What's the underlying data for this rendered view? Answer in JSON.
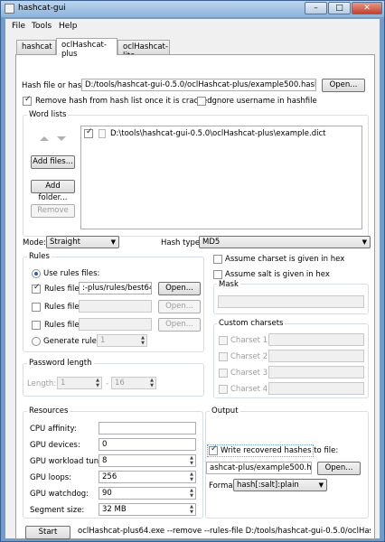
{
  "window": {
    "title": "hashcat-gui",
    "minimize": "–",
    "maximize": "□",
    "close": "✕"
  },
  "menu": [
    "File",
    "Tools",
    "Help"
  ],
  "tabs": [
    "hashcat",
    "oclHashcat-plus",
    "oclHashcat-lite"
  ],
  "hashfile": {
    "label": "Hash file or hash:",
    "value": "D:/tools/hashcat-gui-0.5.0/oclHashcat-plus/example500.hash",
    "open": "Open..."
  },
  "options": {
    "remove_hash": "Remove hash from hash list once it is cracked",
    "ignore_username": "Ignore username in hashfile"
  },
  "wordlists": {
    "title": "Word lists",
    "items": [
      "D:\\tools\\hashcat-gui-0.5.0\\oclHashcat-plus\\example.dict"
    ],
    "add_files": "Add files...",
    "add_folder": "Add folder...",
    "remove": "Remove"
  },
  "mode": {
    "label": "Mode:",
    "value": "Straight"
  },
  "hashtype": {
    "label": "Hash type:",
    "value": "MD5"
  },
  "rules": {
    "title": "Rules",
    "use_rules_files": "Use rules files:",
    "rules_file_label": "Rules file:",
    "rules_file_1": ":-plus/rules/best64.rule",
    "open": "Open...",
    "generate_rules": "Generate rules:",
    "generate_value": "1"
  },
  "charset": {
    "assume_hex": "Assume charset is given in hex",
    "assume_salt_hex": "Assume salt is given in hex"
  },
  "mask": {
    "title": "Mask"
  },
  "custom_charsets": {
    "title": "Custom charsets",
    "items": [
      "Charset 1:",
      "Charset 2:",
      "Charset 3:",
      "Charset 4:"
    ]
  },
  "password_length": {
    "title": "Password length",
    "label": "Length:",
    "min": "1",
    "separator": "-",
    "max": "16"
  },
  "resources": {
    "title": "Resources",
    "cpu_affinity": {
      "label": "CPU affinity:",
      "value": ""
    },
    "gpu_devices": {
      "label": "GPU devices:",
      "value": "0"
    },
    "gpu_workload": {
      "label": "GPU workload tuning:",
      "value": "8"
    },
    "gpu_loops": {
      "label": "GPU loops:",
      "value": "256"
    },
    "gpu_watchdog": {
      "label": "GPU watchdog:",
      "value": "90"
    },
    "segment_size": {
      "label": "Segment size:",
      "value": "32 MB"
    }
  },
  "output": {
    "title": "Output",
    "write_recovered": "Write recovered hashes to file:",
    "file_value": "ashcat-plus/example500.hash.out",
    "open": "Open...",
    "format_label": "Format:",
    "format_value": "hash[:salt]:plain"
  },
  "footer": {
    "start": "Start",
    "command": "oclHashcat-plus64.exe --remove --rules-file D:/tools/hashcat-gui-0.5.0/oclHashcat-plus/rules/best64.rule"
  }
}
